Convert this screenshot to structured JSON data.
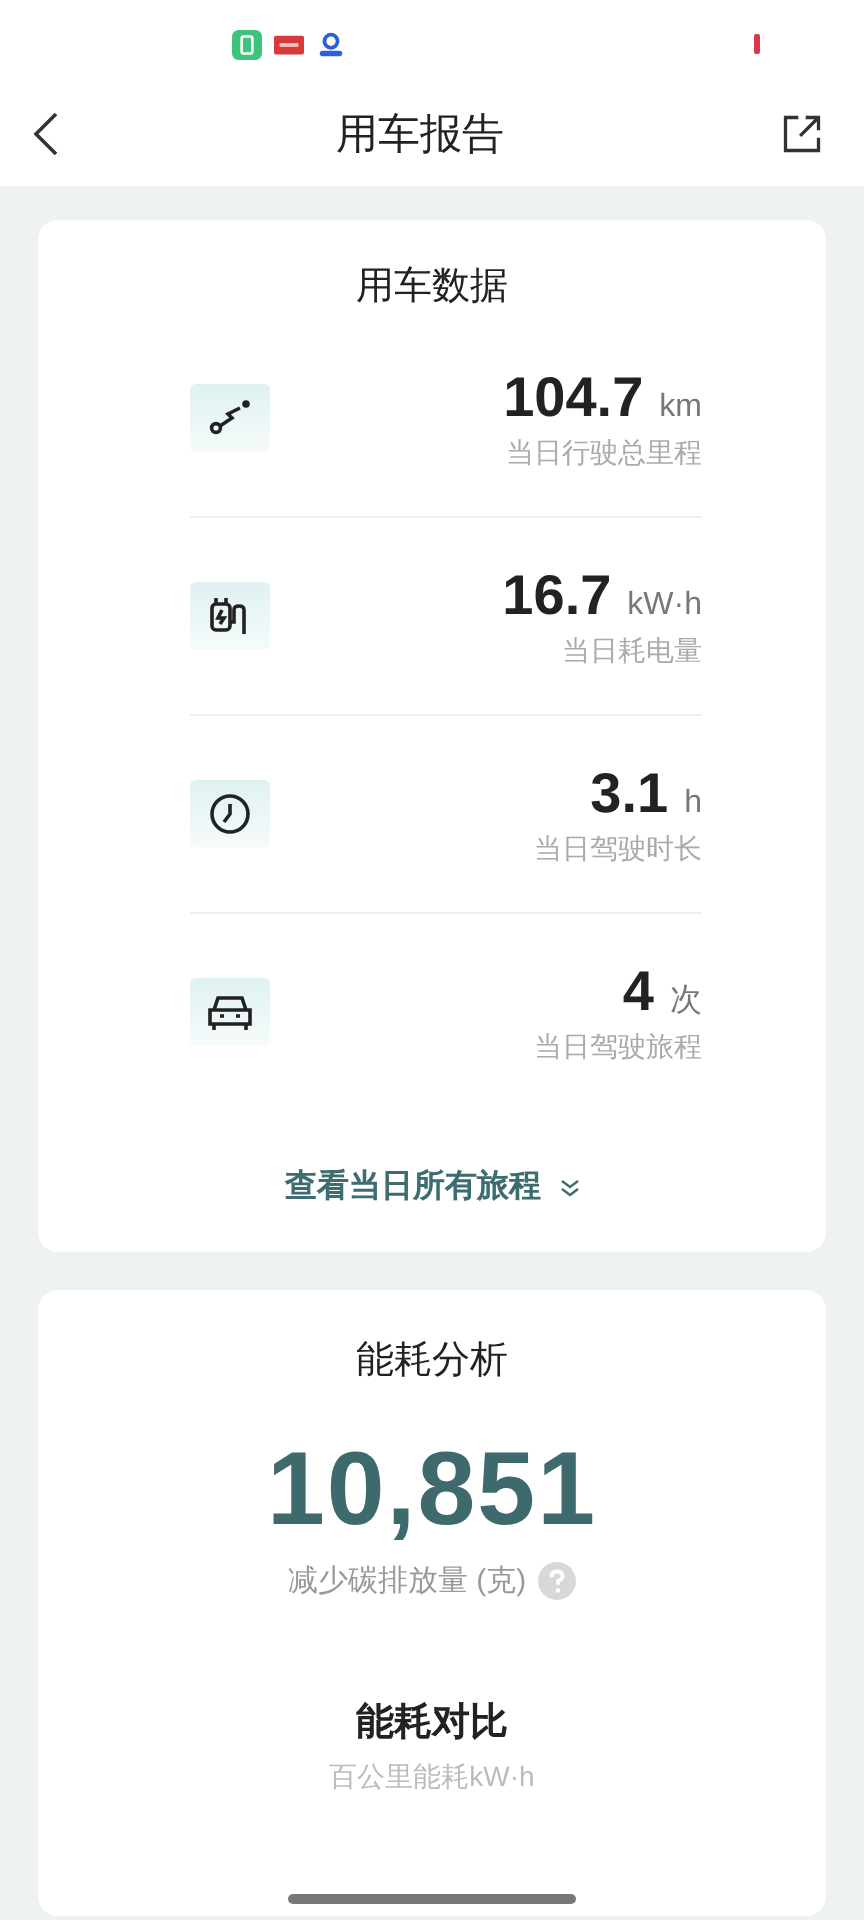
{
  "header": {
    "title": "用车报告"
  },
  "usage": {
    "title": "用车数据",
    "stats": [
      {
        "kind": "route",
        "value": "104.7",
        "unit": "km",
        "label": "当日行驶总里程"
      },
      {
        "kind": "charge",
        "value": "16.7",
        "unit": "kW·h",
        "label": "当日耗电量"
      },
      {
        "kind": "clock",
        "value": "3.1",
        "unit": "h",
        "label": "当日驾驶时长"
      },
      {
        "kind": "car",
        "value": "4",
        "unit": "次",
        "label": "当日驾驶旅程"
      }
    ],
    "link": "查看当日所有旅程"
  },
  "energy": {
    "title": "能耗分析",
    "big_value": "10,851",
    "big_label": "减少碳排放量 (克)",
    "compare_title": "能耗对比",
    "compare_subtitle": "百公里能耗kW·h"
  }
}
